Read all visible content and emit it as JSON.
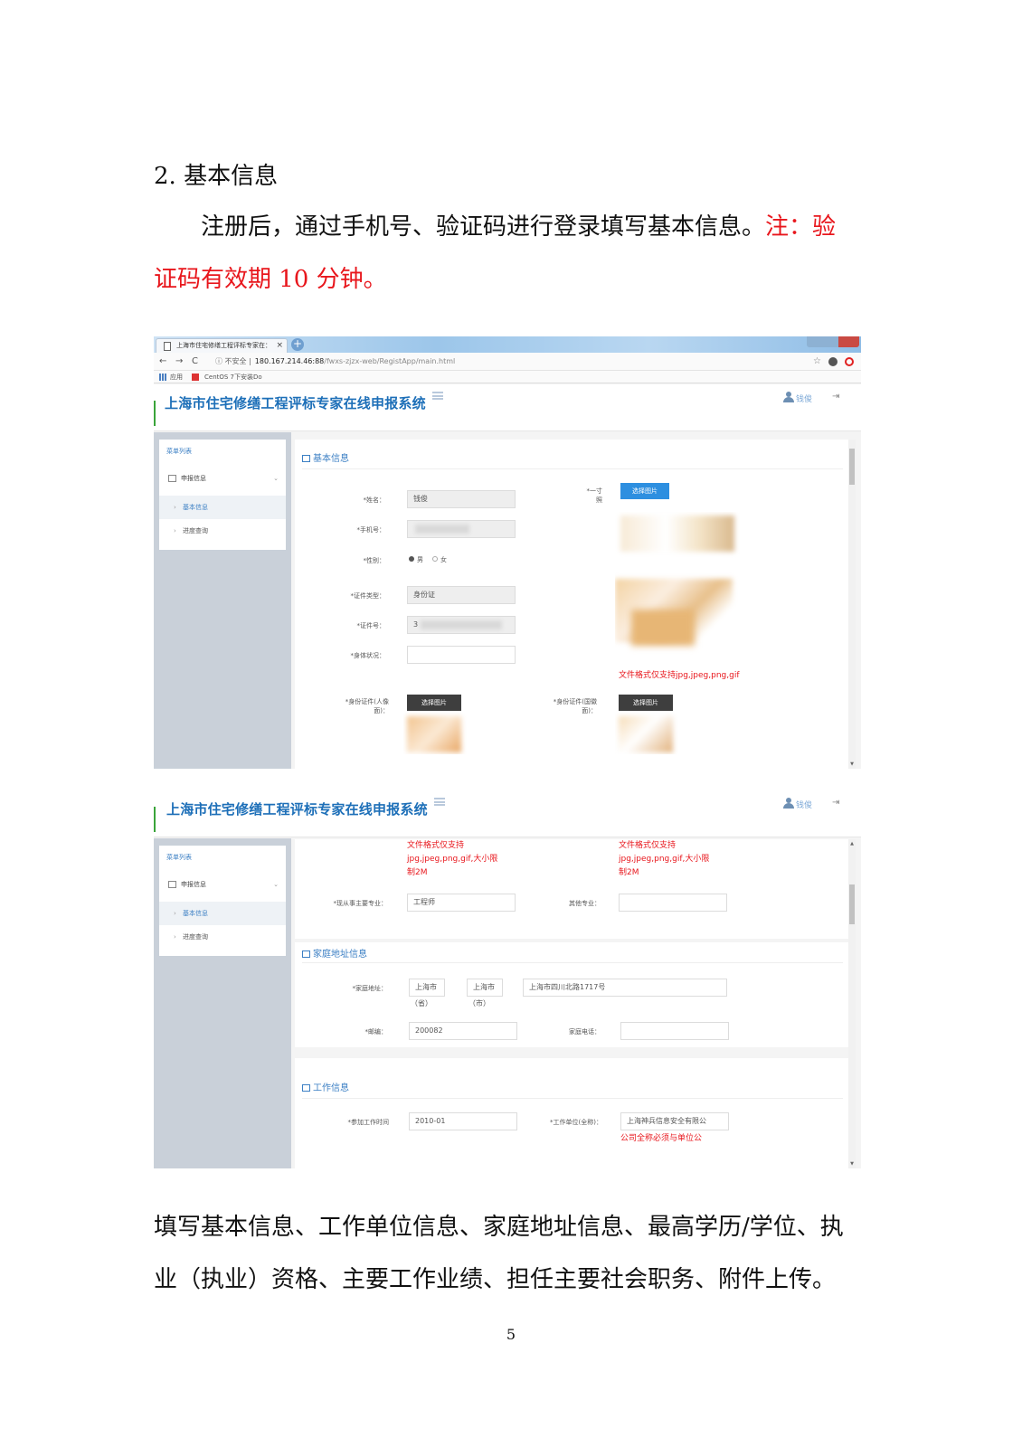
{
  "doc": {
    "heading": "2.  基本信息",
    "intro_black": "注册后，通过手机号、验证码进行登录填写基本信息。",
    "intro_red_1": "注：验",
    "intro_red_2": "证码有效期 10 分钟。",
    "outro_1": "填写基本信息、工作单位信息、家庭地址信息、最高学历/学位、执",
    "outro_2": "业（执业）资格、主要工作业绩、担任主要社会职务、附件上传。",
    "page_number": "5"
  },
  "browser": {
    "tab_title": "上海市住宅修缮工程评标专家在：",
    "tab_close": "×",
    "new_tab": "+",
    "back": "←",
    "forward": "→",
    "reload": "C",
    "insecure": "ⓘ 不安全 |",
    "host": "180.167.214.46:88",
    "path": "/fwxs-zjzx-web/RegistApp/main.html",
    "star": "☆",
    "bookmark_apps": "应用",
    "bookmark_centos": "CentOS 7下安装Do"
  },
  "app": {
    "title": "上海市住宅修缮工程评标专家在线申报系统",
    "user": "钱俊",
    "logout": "⇥",
    "sidebar": {
      "title": "菜单列表",
      "group": "申报信息",
      "chevron": "⌄",
      "items": [
        {
          "label": "基本信息",
          "active": true
        },
        {
          "label": "进度查询",
          "active": false
        }
      ]
    }
  },
  "shot1": {
    "section_title": "基本信息",
    "fields": {
      "name_label": "*姓名：",
      "name_value": "钱俊",
      "phone_label": "*手机号：",
      "gender_label": "*性别：",
      "gender_male": "男",
      "gender_female": "女",
      "id_type_label": "*证件类型：",
      "id_type_value": "身份证",
      "id_no_label": "*证件号：",
      "id_no_value": "3",
      "health_label": "*身体状况：",
      "health_value": "",
      "photo_label_1": "*一寸",
      "photo_label_2": "照",
      "photo_button": "选择图片",
      "photo_hint": "文件格式仅支持jpg,jpeg,png,gif",
      "id_front_label_1": "*身份证件(人像",
      "id_front_label_2": "面)：",
      "id_front_button": "选择图片",
      "id_back_label_1": "*身份证件(国徽",
      "id_back_label_2": "面)：",
      "id_back_button": "选择图片"
    }
  },
  "shot2": {
    "hint_left": [
      "文件格式仅支持",
      "jpg,jpeg,png,gif,大小限",
      "制2M"
    ],
    "hint_right": [
      "文件格式仅支持",
      "jpg,jpeg,png,gif,大小限",
      "制2M"
    ],
    "major_label": "*现从事主要专业：",
    "major_value": "工程师",
    "other_major_label": "其他专业：",
    "other_major_value": "",
    "home_section": "家庭地址信息",
    "address_label": "*家庭地址：",
    "province_value": "上海市",
    "province_unit": "（省）",
    "city_value": "上海市",
    "city_unit": "（市）",
    "street_value": "上海市四川北路1717号",
    "zip_label": "*邮编：",
    "zip_value": "200082",
    "home_phone_label": "家庭电话：",
    "home_phone_value": "",
    "work_section": "工作信息",
    "work_start_label": "*参加工作时间",
    "work_start_value": "2010-01",
    "employer_label": "*工作单位(全称)：",
    "employer_value": "上海神兵信息安全有限公",
    "employer_hint": "公司全称必须与单位公"
  }
}
